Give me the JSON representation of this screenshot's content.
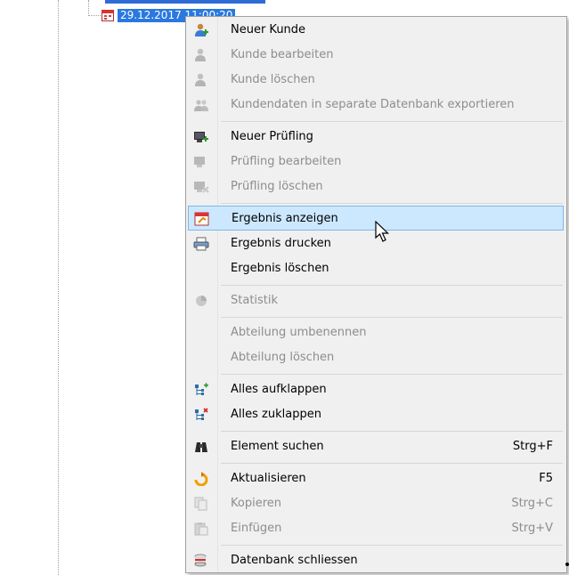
{
  "tree": {
    "node_label": "29.12.2017 11:00:20"
  },
  "menu": {
    "items": [
      {
        "label": "Neuer Kunde",
        "shortcut": "",
        "icon": "user-add-icon",
        "disabled": false
      },
      {
        "label": "Kunde bearbeiten",
        "shortcut": "",
        "icon": "user-edit-icon",
        "disabled": true
      },
      {
        "label": "Kunde löschen",
        "shortcut": "",
        "icon": "user-delete-icon",
        "disabled": true
      },
      {
        "label": "Kundendaten in separate Datenbank exportieren",
        "shortcut": "",
        "icon": "users-export-icon",
        "disabled": true
      },
      {
        "label": "Neuer Prüfling",
        "shortcut": "",
        "icon": "device-add-icon",
        "disabled": false
      },
      {
        "label": "Prüfling bearbeiten",
        "shortcut": "",
        "icon": "device-edit-icon",
        "disabled": true
      },
      {
        "label": "Prüfling löschen",
        "shortcut": "",
        "icon": "device-delete-icon",
        "disabled": true
      },
      {
        "label": "Ergebnis anzeigen",
        "shortcut": "",
        "icon": "calendar-result-icon",
        "disabled": false
      },
      {
        "label": "Ergebnis drucken",
        "shortcut": "",
        "icon": "printer-icon",
        "disabled": false
      },
      {
        "label": "Ergebnis löschen",
        "shortcut": "",
        "icon": "",
        "disabled": false
      },
      {
        "label": "Statistik",
        "shortcut": "",
        "icon": "statistics-icon",
        "disabled": true
      },
      {
        "label": "Abteilung umbenennen",
        "shortcut": "",
        "icon": "",
        "disabled": true
      },
      {
        "label": "Abteilung löschen",
        "shortcut": "",
        "icon": "",
        "disabled": true
      },
      {
        "label": "Alles aufklappen",
        "shortcut": "",
        "icon": "tree-expand-icon",
        "disabled": false
      },
      {
        "label": "Alles zuklappen",
        "shortcut": "",
        "icon": "tree-collapse-icon",
        "disabled": false
      },
      {
        "label": "Element suchen",
        "shortcut": "Strg+F",
        "icon": "binoculars-icon",
        "disabled": false
      },
      {
        "label": "Aktualisieren",
        "shortcut": "F5",
        "icon": "refresh-icon",
        "disabled": false
      },
      {
        "label": "Kopieren",
        "shortcut": "Strg+C",
        "icon": "copy-icon",
        "disabled": true
      },
      {
        "label": "Einfügen",
        "shortcut": "Strg+V",
        "icon": "paste-icon",
        "disabled": true
      },
      {
        "label": "Datenbank schliessen",
        "shortcut": "",
        "icon": "database-close-icon",
        "disabled": false
      }
    ],
    "highlighted_index": 7
  }
}
